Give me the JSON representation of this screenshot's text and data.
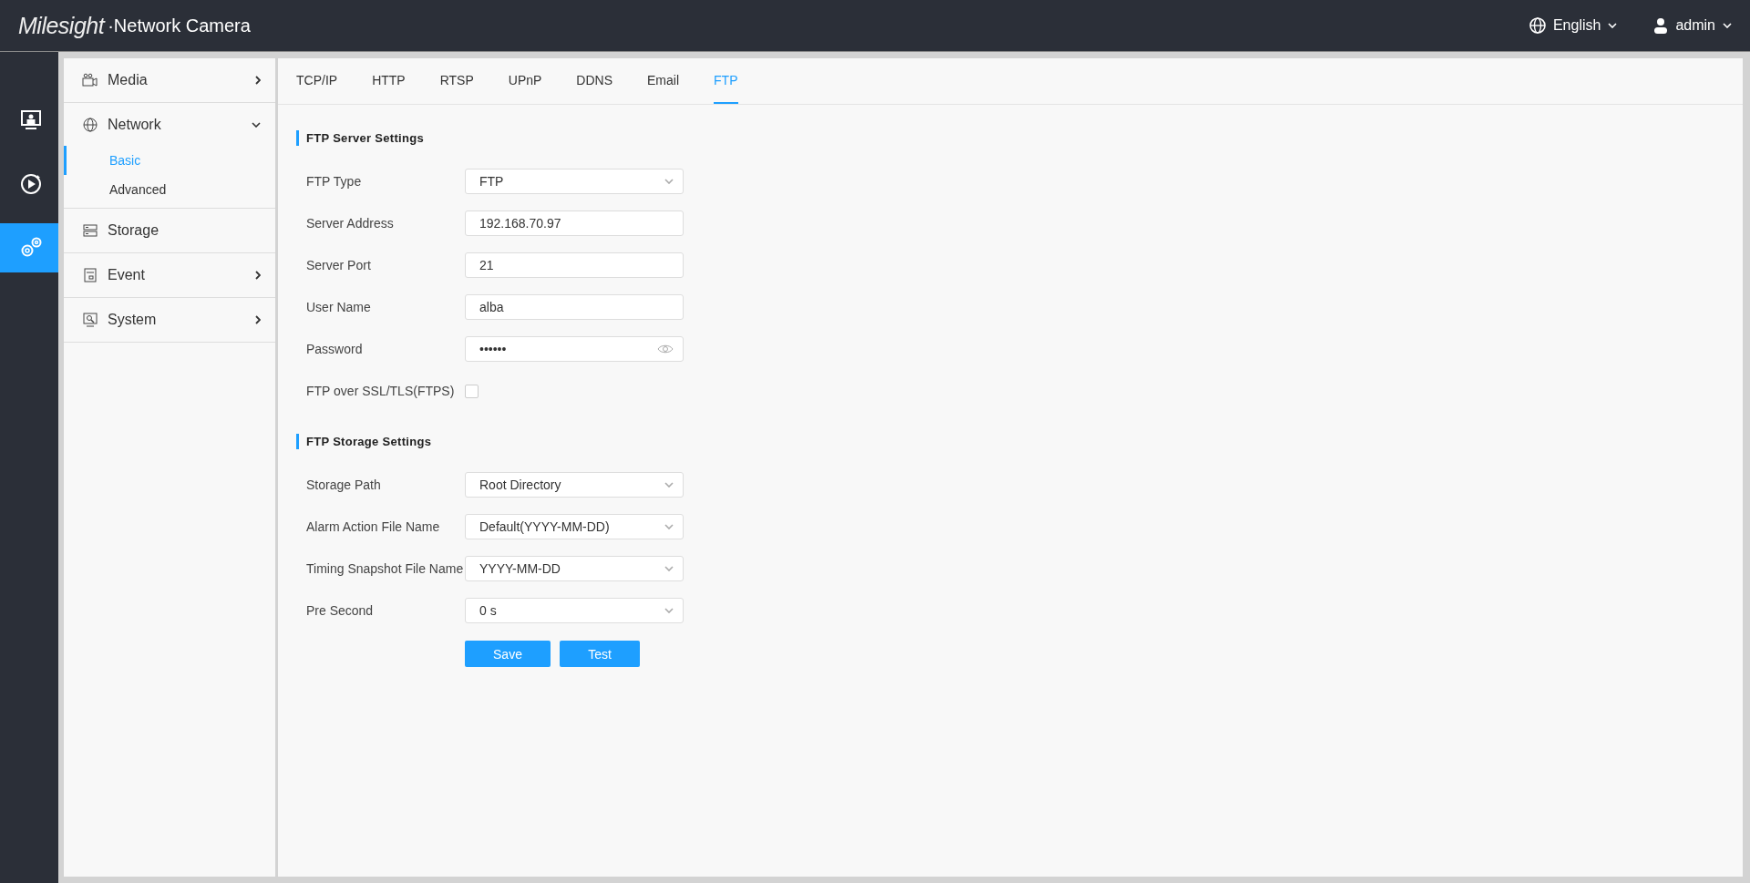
{
  "header": {
    "brand": "Milesight",
    "product": "·Network Camera",
    "language": "English",
    "user": "admin"
  },
  "rail": [
    {
      "kind": "live",
      "selected": false
    },
    {
      "kind": "playback",
      "selected": false
    },
    {
      "kind": "settings",
      "selected": true
    }
  ],
  "menu": [
    {
      "label": "Media",
      "expanded": false
    },
    {
      "label": "Network",
      "expanded": true,
      "children": [
        {
          "label": "Basic",
          "selected": true
        },
        {
          "label": "Advanced",
          "selected": false
        }
      ]
    },
    {
      "label": "Storage"
    },
    {
      "label": "Event",
      "expanded": false
    },
    {
      "label": "System",
      "expanded": false
    }
  ],
  "tabs": [
    {
      "label": "TCP/IP",
      "selected": false
    },
    {
      "label": "HTTP",
      "selected": false
    },
    {
      "label": "RTSP",
      "selected": false
    },
    {
      "label": "UPnP",
      "selected": false
    },
    {
      "label": "DDNS",
      "selected": false
    },
    {
      "label": "Email",
      "selected": false
    },
    {
      "label": "FTP",
      "selected": true
    }
  ],
  "sections": [
    {
      "title": "FTP Server Settings",
      "fields": [
        {
          "kind": "select",
          "label": "FTP Type",
          "value": "FTP"
        },
        {
          "kind": "text",
          "label": "Server Address",
          "value": "192.168.70.97"
        },
        {
          "kind": "text",
          "label": "Server Port",
          "value": "21"
        },
        {
          "kind": "text",
          "label": "User Name",
          "value": "alba"
        },
        {
          "kind": "password",
          "label": "Password",
          "value": "••••••"
        },
        {
          "kind": "checkbox",
          "label": "FTP over SSL/TLS(FTPS)",
          "checked": false
        }
      ]
    },
    {
      "title": "FTP Storage Settings",
      "fields": [
        {
          "kind": "select",
          "label": "Storage Path",
          "value": "Root Directory"
        },
        {
          "kind": "select",
          "label": "Alarm Action File Name",
          "value": "Default(YYYY-MM-DD)"
        },
        {
          "kind": "select",
          "label": "Timing Snapshot File Name",
          "value": "YYYY-MM-DD"
        },
        {
          "kind": "select",
          "label": "Pre Second",
          "value": "0 s"
        }
      ]
    }
  ],
  "buttons": [
    "Save",
    "Test"
  ]
}
